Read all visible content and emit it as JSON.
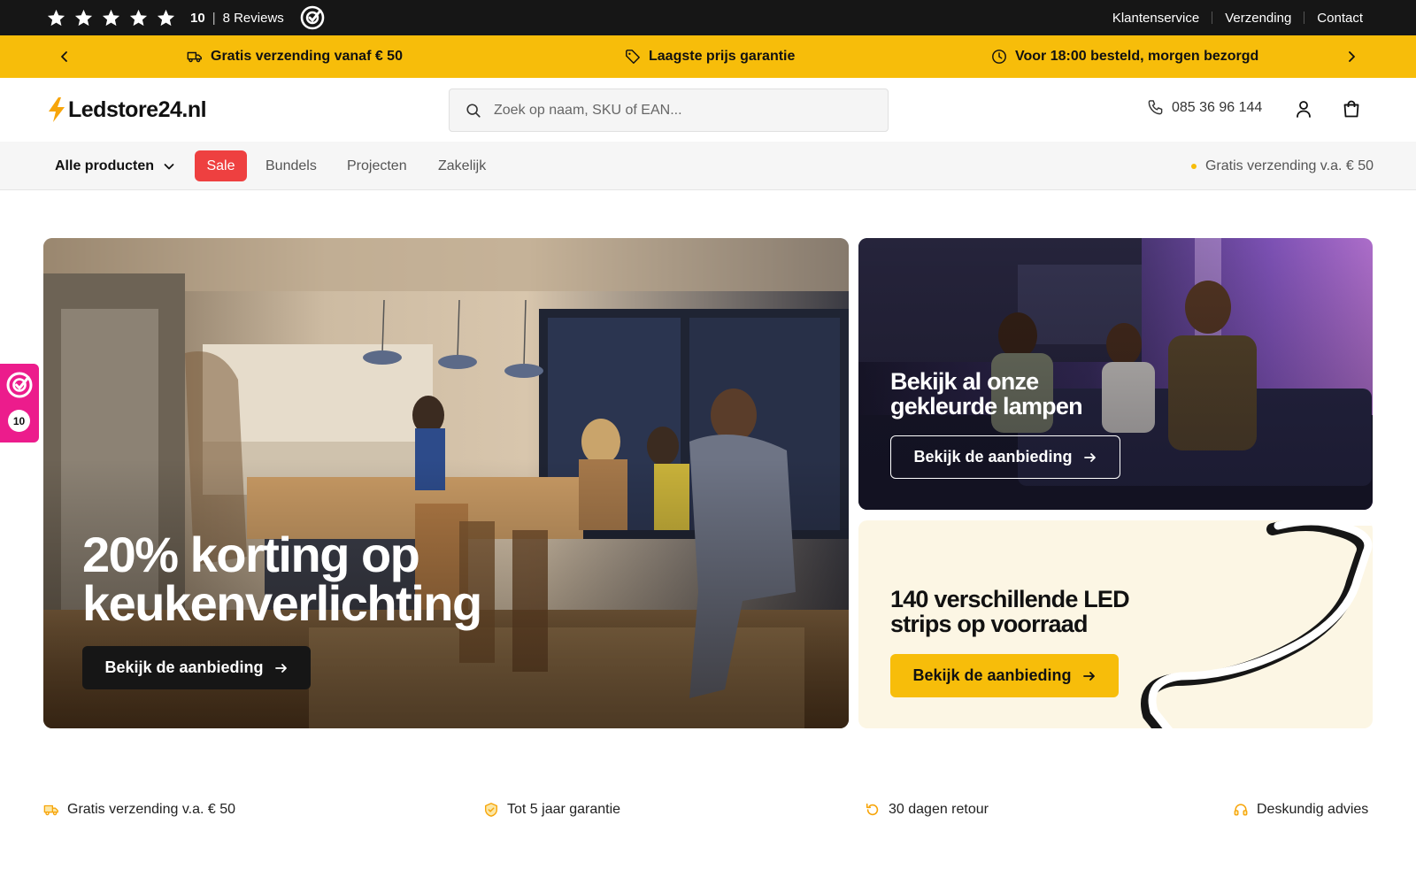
{
  "topbar": {
    "rating_score": "10",
    "separator": "|",
    "reviews_label": "8 Reviews",
    "links": [
      "Klantenservice",
      "Verzending",
      "Contact"
    ]
  },
  "usp_bar": {
    "items": [
      {
        "icon": "truck-icon",
        "label": "Gratis verzending vanaf € 50"
      },
      {
        "icon": "tag-icon",
        "label": "Laagste prijs garantie"
      },
      {
        "icon": "clock-icon",
        "label": "Voor 18:00 besteld, morgen bezorgd"
      }
    ]
  },
  "header": {
    "logo_text": "Ledstore24.nl",
    "search_placeholder": "Zoek op naam, SKU of EAN...",
    "phone": "085 36 96 144"
  },
  "nav": {
    "all_products": "Alle producten",
    "sale": "Sale",
    "links": [
      "Bundels",
      "Projecten",
      "Zakelijk"
    ],
    "shipping_info": "Gratis verzending v.a. € 50"
  },
  "hero": {
    "main": {
      "title": "20% korting op\nkeukenverlichting",
      "button": "Bekijk de aanbieding"
    },
    "top_right": {
      "title": "Bekijk al onze\ngekleurde lampen",
      "button": "Bekijk de aanbieding"
    },
    "bottom_right": {
      "title": "140 verschillende LED\nstrips op voorraad",
      "button": "Bekijk de aanbieding"
    }
  },
  "usp_row": {
    "items": [
      {
        "icon": "truck-icon",
        "label": "Gratis verzending v.a. € 50"
      },
      {
        "icon": "shield-check-icon",
        "label": "Tot 5 jaar garantie"
      },
      {
        "icon": "return-icon",
        "label": "30 dagen retour"
      },
      {
        "icon": "headset-icon",
        "label": "Deskundig advies"
      }
    ]
  },
  "side_badge": {
    "score": "10"
  },
  "colors": {
    "brand_yellow": "#f7bd0a",
    "sale_red": "#ee4040",
    "kiyoh_pink": "#ec1c8c",
    "topbar_black": "#161616"
  }
}
